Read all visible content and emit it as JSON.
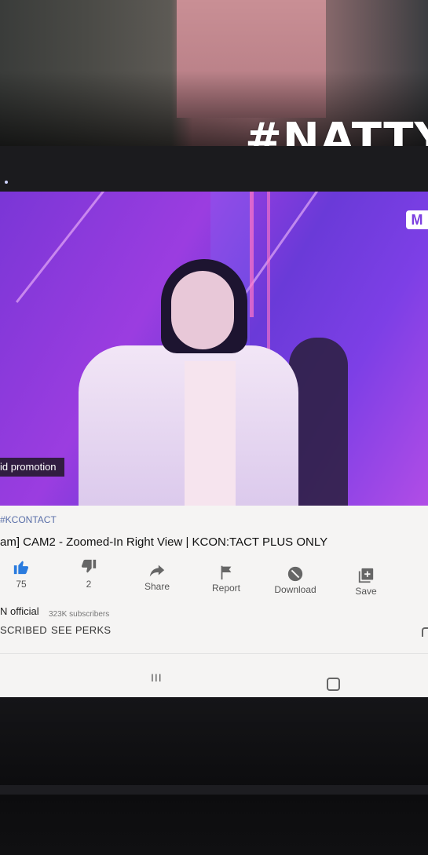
{
  "story": {
    "hashtag": "#NATTY"
  },
  "video": {
    "channel_logo": "M",
    "overlay_badge": "id promotion"
  },
  "info": {
    "hashtag_link": "#KCONTACT",
    "title": "am] CAM2 - Zoomed-In Right View | KCON:TACT PLUS ONLY",
    "actions": [
      {
        "icon": "thumbs-up-icon",
        "label": "75"
      },
      {
        "icon": "thumbs-down-icon",
        "label": "2"
      },
      {
        "icon": "share-icon",
        "label": "Share"
      },
      {
        "icon": "flag-icon",
        "label": "Report"
      },
      {
        "icon": "download-icon",
        "label": "Download"
      },
      {
        "icon": "save-icon",
        "label": "Save"
      }
    ],
    "channel_name": "N official",
    "subscribers": "323K subscribers",
    "subscribed_label": "SCRIBED",
    "see_perks_label": "SEE PERKS"
  },
  "nav": {
    "recent_glyph": "III"
  },
  "colors": {
    "like_active": "#2a7bde",
    "icon_gray": "#666666"
  }
}
